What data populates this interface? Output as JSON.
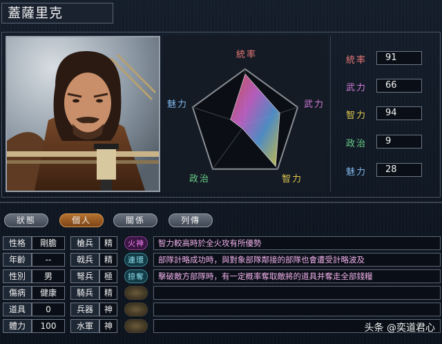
{
  "officer": {
    "name": "蓋薩里克"
  },
  "radar": {
    "labels": [
      "統率",
      "武力",
      "智力",
      "政治",
      "魅力"
    ]
  },
  "stats": [
    {
      "label": "統率",
      "value": "91"
    },
    {
      "label": "武力",
      "value": "66"
    },
    {
      "label": "智力",
      "value": "94"
    },
    {
      "label": "政治",
      "value": "9"
    },
    {
      "label": "魅力",
      "value": "28"
    }
  ],
  "tabs": [
    {
      "label": "狀態"
    },
    {
      "label": "個人"
    },
    {
      "label": "關係"
    },
    {
      "label": "列傳"
    }
  ],
  "info": [
    {
      "label": "性格",
      "value": "剛膽"
    },
    {
      "label": "年齡",
      "value": "--"
    },
    {
      "label": "性別",
      "value": "男"
    },
    {
      "label": "傷病",
      "value": "健康"
    },
    {
      "label": "道具",
      "value": "0"
    },
    {
      "label": "體力",
      "value": "100"
    }
  ],
  "aptitude": [
    {
      "label": "槍兵",
      "value": "精"
    },
    {
      "label": "戟兵",
      "value": "精"
    },
    {
      "label": "弩兵",
      "value": "極"
    },
    {
      "label": "騎兵",
      "value": "精"
    },
    {
      "label": "兵器",
      "value": "神"
    },
    {
      "label": "水軍",
      "value": "神"
    }
  ],
  "skills": [
    {
      "name": "火神",
      "desc": "智力較高時於全火攻有所優勢"
    },
    {
      "name": "連環",
      "desc": "部隊計略成功時，與對象部隊鄰接的部隊也會遭受計略波及"
    },
    {
      "name": "掠奪",
      "desc": "擊破敵方部隊時，有一定概率奪取敵將的道具并奪走全部錢糧"
    }
  ],
  "colors": {
    "leadership": "#e87878",
    "war": "#d27bd8",
    "intelligence": "#e0c850",
    "politics": "#6bd08a",
    "charm": "#7fb4e8",
    "active_tab": "#b5722e"
  },
  "watermark": "头条 @奕道君心"
}
